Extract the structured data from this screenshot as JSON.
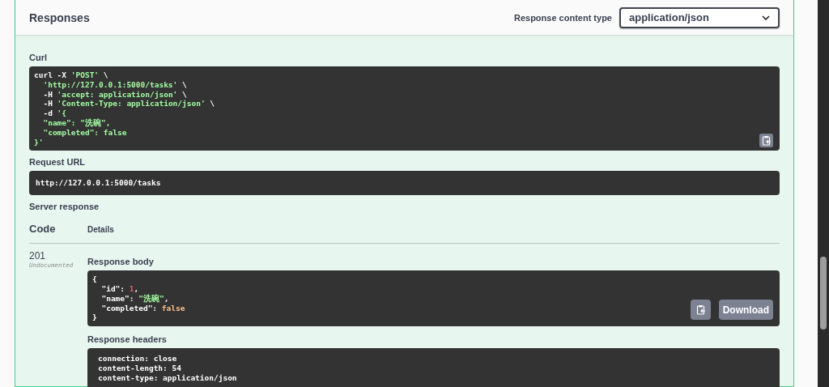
{
  "header": {
    "title": "Responses",
    "content_type_label": "Response content type",
    "content_type_value": "application/json"
  },
  "curl": {
    "label": "Curl",
    "lines": [
      [
        {
          "text": "curl -X ",
          "kind": "plain"
        },
        {
          "text": "'POST'",
          "kind": "string"
        },
        {
          "text": " \\",
          "kind": "plain"
        }
      ],
      [
        {
          "text": "  'http://127.0.0.1:5000/tasks'",
          "kind": "string"
        },
        {
          "text": " \\",
          "kind": "plain"
        }
      ],
      [
        {
          "text": "  -H ",
          "kind": "plain"
        },
        {
          "text": "'accept: application/json'",
          "kind": "string"
        },
        {
          "text": " \\",
          "kind": "plain"
        }
      ],
      [
        {
          "text": "  -H ",
          "kind": "plain"
        },
        {
          "text": "'Content-Type: application/json'",
          "kind": "string"
        },
        {
          "text": " \\",
          "kind": "plain"
        }
      ],
      [
        {
          "text": "  -d ",
          "kind": "plain"
        },
        {
          "text": "'{",
          "kind": "string"
        }
      ],
      [
        {
          "text": "  \"name\": \"洗碗\",",
          "kind": "string"
        }
      ],
      [
        {
          "text": "  \"completed\": false",
          "kind": "string"
        }
      ],
      [
        {
          "text": "}'",
          "kind": "string"
        }
      ]
    ]
  },
  "request_url": {
    "label": "Request URL",
    "value": "http://127.0.0.1:5000/tasks"
  },
  "server_response": {
    "label": "Server response",
    "columns": [
      "Code",
      "Details"
    ],
    "code": "201",
    "code_note": "Undocumented",
    "body_label": "Response body",
    "body_lines": [
      [
        {
          "text": "{",
          "kind": "plain"
        }
      ],
      [
        {
          "text": "  \"id\": ",
          "kind": "plain"
        },
        {
          "text": "1",
          "kind": "number"
        },
        {
          "text": ",",
          "kind": "plain"
        }
      ],
      [
        {
          "text": "  \"name\": ",
          "kind": "plain"
        },
        {
          "text": "\"洗碗\"",
          "kind": "string"
        },
        {
          "text": ",",
          "kind": "plain"
        }
      ],
      [
        {
          "text": "  \"completed\": ",
          "kind": "plain"
        },
        {
          "text": "false",
          "kind": "bool"
        }
      ],
      [
        {
          "text": "}",
          "kind": "plain"
        }
      ]
    ],
    "download_label": "Download",
    "headers_label": "Response headers",
    "headers_lines": [
      "connection: close",
      "content-length: 54",
      "content-type: application/json"
    ]
  }
}
